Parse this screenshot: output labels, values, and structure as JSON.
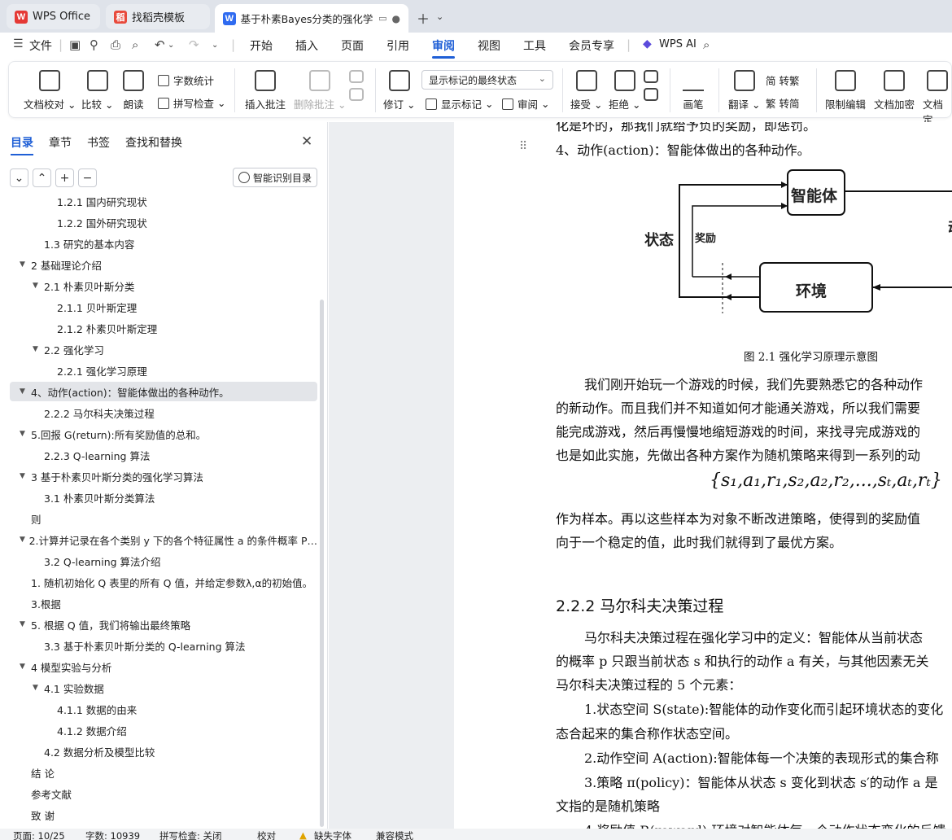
{
  "tabs": [
    {
      "label": "WPS Office"
    },
    {
      "label": "找稻壳模板"
    },
    {
      "label": "基于朴素Bayes分类的强化学"
    }
  ],
  "menu": {
    "file": "文件",
    "items": [
      "开始",
      "插入",
      "页面",
      "引用",
      "审阅",
      "视图",
      "工具",
      "会员专享"
    ],
    "active": "审阅",
    "ai": "WPS AI"
  },
  "ribbon": {
    "doc_proofread": "文档校对",
    "compare": "比较",
    "read_aloud": "朗读",
    "word_count": "字数统计",
    "spell_check": "拼写检查",
    "insert_comment": "插入批注",
    "delete_comment": "删除批注",
    "revise": "修订",
    "display_select": "显示标记的最终状态",
    "show_markup": "显示标记",
    "review_pane": "审阅",
    "accept": "接受",
    "reject": "拒绝",
    "pen": "画笔",
    "translate": "翻译",
    "to_traditional": "简 转繁",
    "to_simplified": "繁 转简",
    "restrict_edit": "限制编辑",
    "encrypt": "文档加密",
    "finalize": "文档定"
  },
  "sidebar": {
    "tabs": [
      "目录",
      "章节",
      "书签",
      "查找和替换"
    ],
    "smart_toc": "智能识别目录",
    "toc": [
      {
        "label": "1.2.1  国内研究现状",
        "level": 3,
        "arrow": ""
      },
      {
        "label": "1.2.2  国外研究现状",
        "level": 3,
        "arrow": ""
      },
      {
        "label": "1.3  研究的基本内容",
        "level": 2,
        "arrow": ""
      },
      {
        "label": "2  基础理论介绍",
        "level": 1,
        "arrow": "▼"
      },
      {
        "label": "2.1  朴素贝叶斯分类",
        "level": 2,
        "arrow": "▼"
      },
      {
        "label": "2.1.1  贝叶斯定理",
        "level": 3,
        "arrow": ""
      },
      {
        "label": "2.1.2  朴素贝叶斯定理",
        "level": 3,
        "arrow": ""
      },
      {
        "label": "2.2  强化学习",
        "level": 2,
        "arrow": "▼"
      },
      {
        "label": "2.2.1  强化学习原理",
        "level": 3,
        "arrow": ""
      },
      {
        "label": "4、动作(action)：智能体做出的各种动作。",
        "level": 1,
        "arrow": "▼",
        "active": true
      },
      {
        "label": "2.2.2  马尔科夫决策过程",
        "level": 2,
        "arrow": ""
      },
      {
        "label": "5.回报 G(return):所有奖励值的总和。",
        "level": 1,
        "arrow": "▼"
      },
      {
        "label": "2.2.3 Q-learning 算法",
        "level": 2,
        "arrow": ""
      },
      {
        "label": "3  基于朴素贝叶斯分类的强化学习算法",
        "level": 1,
        "arrow": "▼"
      },
      {
        "label": "3.1  朴素贝叶斯分类算法",
        "level": 2,
        "arrow": ""
      },
      {
        "label": "则",
        "level": 1,
        "arrow": ""
      },
      {
        "label": "2.计算并记录在各个类别 y 下的各个特征属性 a 的条件概率 P…",
        "level": 1,
        "arrow": "▼"
      },
      {
        "label": "3.2 Q-learning 算法介绍",
        "level": 2,
        "arrow": ""
      },
      {
        "label": "1. 随机初始化 Q 表里的所有 Q 值，并给定参数λ,α的初始值。",
        "level": 1,
        "arrow": ""
      },
      {
        "label": "3.根据",
        "level": 1,
        "arrow": ""
      },
      {
        "label": "5. 根据 Q 值，我们将输出最终策略",
        "level": 1,
        "arrow": "▼"
      },
      {
        "label": "3.3  基于朴素贝叶斯分类的 Q-learning 算法",
        "level": 2,
        "arrow": ""
      },
      {
        "label": "4  模型实验与分析",
        "level": 1,
        "arrow": "▼"
      },
      {
        "label": "4.1  实验数据",
        "level": 2,
        "arrow": "▼"
      },
      {
        "label": "4.1.1  数据的由来",
        "level": 3,
        "arrow": ""
      },
      {
        "label": "4.1.2  数据介绍",
        "level": 3,
        "arrow": ""
      },
      {
        "label": "4.2 数据分析及模型比较",
        "level": 2,
        "arrow": ""
      },
      {
        "label": "结  论",
        "level": 1,
        "arrow": ""
      },
      {
        "label": "参考文献",
        "level": 1,
        "arrow": ""
      },
      {
        "label": "致  谢",
        "level": 1,
        "arrow": ""
      }
    ]
  },
  "document": {
    "top_cut": "化是坏的，那我们就给予负的奖励，即惩罚。",
    "item4": "4、动作(action)：智能体做出的各种动作。",
    "figure": {
      "agent": "智能体",
      "env": "环境",
      "state": "状态",
      "reward": "奖励",
      "action_cut": "动",
      "caption": "图 2.1  强化学习原理示意图"
    },
    "para1": [
      "我们刚开始玩一个游戏的时候，我们先要熟悉它的各种动作",
      "的新动作。而且我们并不知道如何才能通关游戏，所以我们需要",
      "能完成游戏，然后再慢慢地缩短游戏的时间，来找寻完成游戏的",
      "也是如此实施，先做出各种方案作为随机策略来得到一系列的动"
    ],
    "formula": "{s₁,a₁,r₁,s₂,a₂,r₂,...,sₜ,aₜ,rₜ}",
    "para2": [
      "作为样本。再以这些样本为对象不断改进策略，使得到的奖励值",
      "向于一个稳定的值，此时我们就得到了最优方案。"
    ],
    "heading": "2.2.2  马尔科夫决策过程",
    "para3": [
      "马尔科夫决策过程在强化学习中的定义：智能体从当前状态",
      "的概率 p 只跟当前状态 s 和执行的动作 a 有关，与其他因素无关",
      "马尔科夫决策过程的 5 个元素："
    ],
    "list": [
      "1.状态空间 S(state):智能体的动作变化而引起环境状态的变化",
      "态合起来的集合称作状态空间。",
      "2.动作空间 A(action):智能体每一个决策的表现形式的集合称",
      "3.策略 π(policy)：智能体从状态 s 变化到状态 s′的动作 a 是",
      "文指的是随机策略",
      "4.奖励值 R(reward):环境对智能体每一个动作状态变化的反馈"
    ]
  },
  "status": {
    "page": "页面: 10/25",
    "words": "字数: 10939",
    "spell": "拼写检查: 关闭",
    "proof": "校对",
    "missing_font": "缺失字体",
    "compat": "兼容模式"
  }
}
